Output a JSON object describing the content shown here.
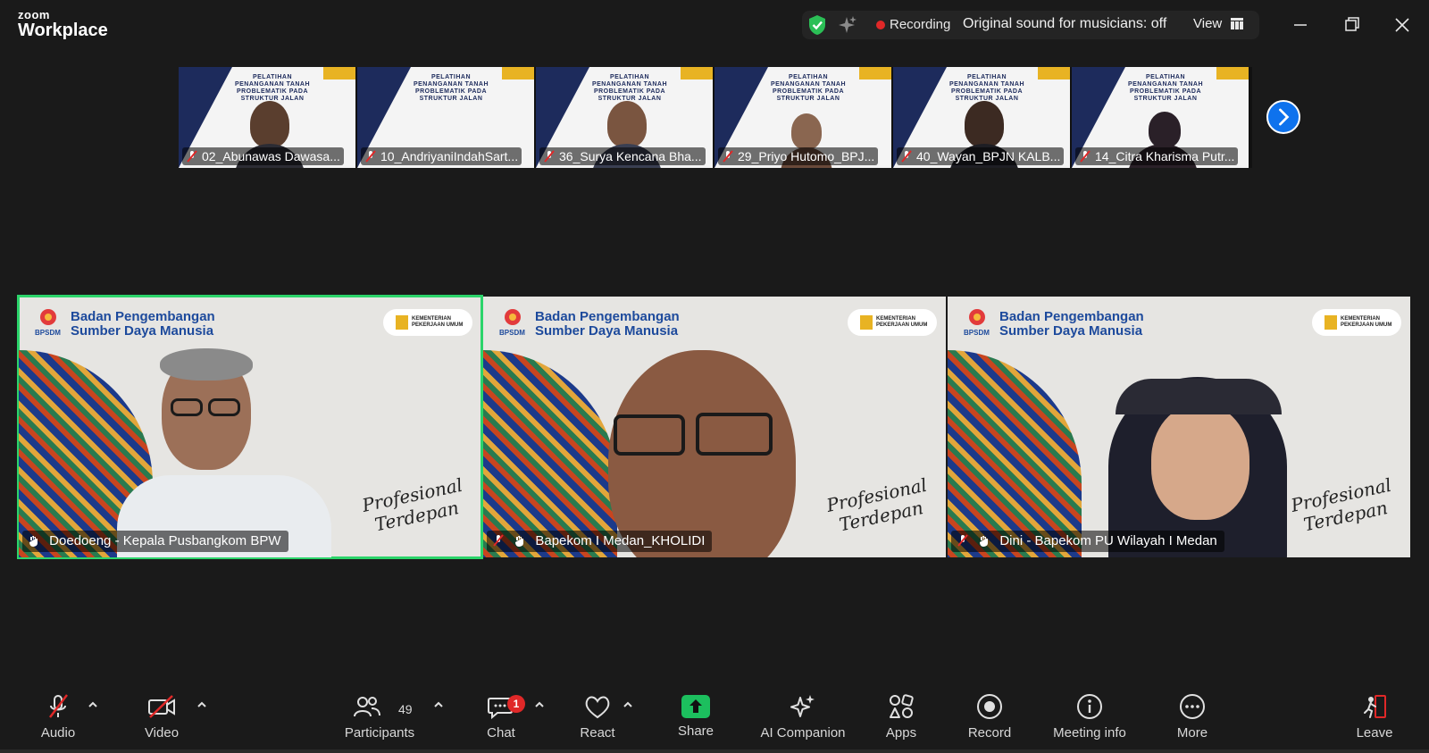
{
  "app": {
    "logo_small": "zoom",
    "logo_large": "Workplace"
  },
  "status_bar": {
    "recording_label": "Recording",
    "original_sound": "Original sound for musicians: off",
    "view_label": "View"
  },
  "filmstrip": {
    "thumbnails": [
      {
        "name": "02_Abunawas Dawasa..."
      },
      {
        "name": "10_AndriyaniIndahSart..."
      },
      {
        "name": "36_Surya Kencana Bha..."
      },
      {
        "name": "29_Priyo Hutomo_BPJ..."
      },
      {
        "name": "40_Wayan_BPJN KALB..."
      },
      {
        "name": "14_Citra Kharisma Putr..."
      }
    ]
  },
  "tiles": [
    {
      "name": "Doedoeng - Kepala Pusbangkom BPW",
      "org_line1": "Badan Pengembangan",
      "org_line2": "Sumber Daya Manusia",
      "org_abbr": "BPSDM",
      "ministry": "KEMENTERIAN PEKERJAAN UMUM",
      "slogan_line1": "Profesional",
      "slogan_line2": "Terdepan"
    },
    {
      "name": "Bapekom I Medan_KHOLIDI",
      "org_line1": "Badan Pengembangan",
      "org_line2": "Sumber Daya Manusia",
      "org_abbr": "BPSDM",
      "ministry": "KEMENTERIAN PEKERJAAN UMUM",
      "slogan_line1": "Profesional",
      "slogan_line2": "Terdepan"
    },
    {
      "name": "Dini - Bapekom PU Wilayah I Medan",
      "org_line1": "Badan Pengembangan",
      "org_line2": "Sumber Daya Manusia",
      "org_abbr": "BPSDM",
      "ministry": "KEMENTERIAN PEKERJAAN UMUM",
      "slogan_line1": "Profesional",
      "slogan_line2": "Terdepan"
    }
  ],
  "toolbar": {
    "audio": "Audio",
    "video": "Video",
    "participants": "Participants",
    "participants_count": "49",
    "chat": "Chat",
    "chat_badge": "1",
    "react": "React",
    "share": "Share",
    "ai_companion": "AI Companion",
    "apps": "Apps",
    "record": "Record",
    "meeting_info": "Meeting info",
    "more": "More",
    "leave": "Leave"
  },
  "colors": {
    "accent_blue": "#0e72ed",
    "active_speaker": "#2bd46a",
    "recording_red": "#e02828",
    "share_green": "#1cbf5e"
  }
}
